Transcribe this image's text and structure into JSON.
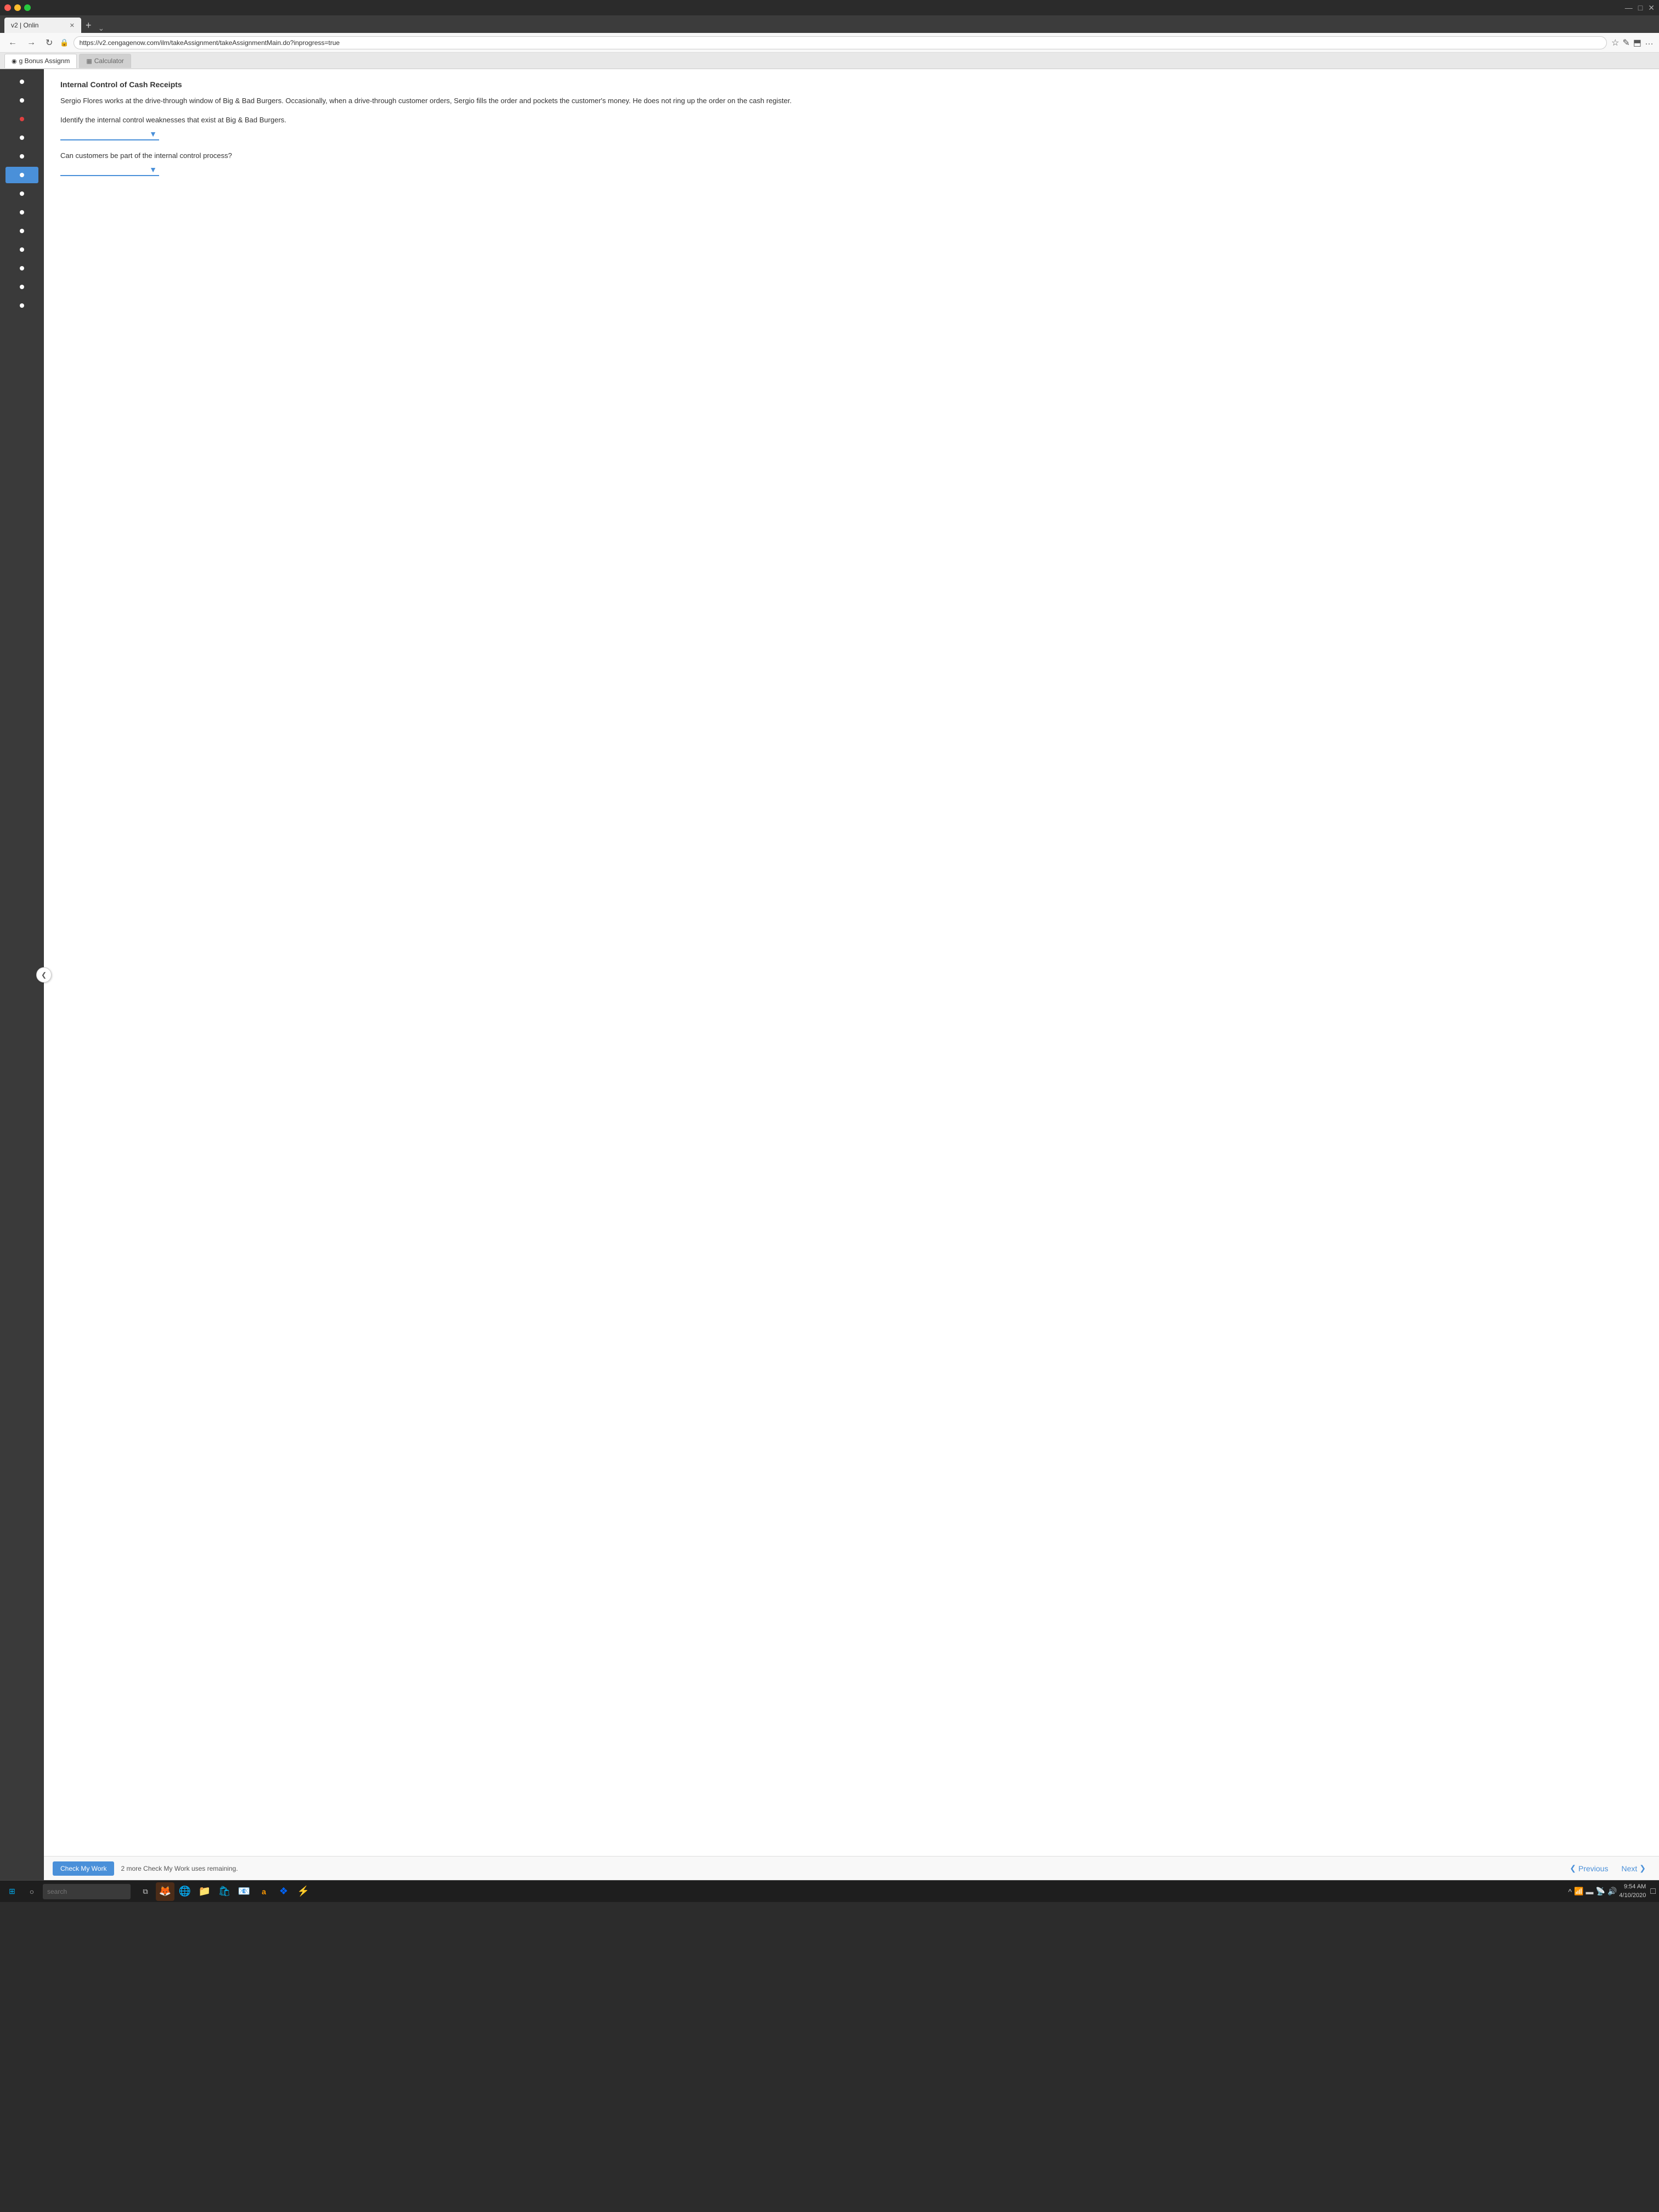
{
  "browser": {
    "tab_label": "v2 | Onlin",
    "url": "https://v2.cengagenow.com/ilm/takeAssignment/takeAssignmentMain.do?inprogress=true"
  },
  "app": {
    "tab_bonus": "g Bonus Assignm",
    "tab_calculator": "Calculator",
    "question_title": "Internal Control of Cash Receipts",
    "question_body": "Sergio Flores works at the drive-through window of Big & Bad Burgers. Occasionally, when a drive-through customer orders, Sergio fills the order and pockets the customer's money. He does not ring up the order on the cash register.",
    "question_prompt1": "Identify the internal control weaknesses that exist at Big & Bad Burgers.",
    "question_prompt2": "Can customers be part of the internal control process?",
    "check_my_work_label": "Check My Work",
    "remaining_label": "2 more Check My Work uses remaining.",
    "previous_label": "Previous",
    "next_label": "Next"
  },
  "sidebar": {
    "items": [
      {
        "id": 1,
        "active": false,
        "has_x": false
      },
      {
        "id": 2,
        "active": false,
        "has_x": false
      },
      {
        "id": 3,
        "active": false,
        "has_x": true
      },
      {
        "id": 4,
        "active": false,
        "has_x": false
      },
      {
        "id": 5,
        "active": false,
        "has_x": false
      },
      {
        "id": 6,
        "active": true,
        "has_x": false
      },
      {
        "id": 7,
        "active": false,
        "has_x": false
      },
      {
        "id": 8,
        "active": false,
        "has_x": false
      },
      {
        "id": 9,
        "active": false,
        "has_x": false
      },
      {
        "id": 10,
        "active": false,
        "has_x": false
      },
      {
        "id": 11,
        "active": false,
        "has_x": false
      },
      {
        "id": 12,
        "active": false,
        "has_x": false
      },
      {
        "id": 13,
        "active": false,
        "has_x": false
      }
    ]
  },
  "taskbar": {
    "search_placeholder": "search",
    "time": "9:54 AM",
    "date": "4/10/2020"
  },
  "icons": {
    "chevron_left": "❮",
    "chevron_right": "❯",
    "arrow_down": "▼",
    "question_mark": "?",
    "lock": "🔒",
    "star": "☆",
    "profile": "✎",
    "share": "⬒",
    "dots": "…"
  }
}
